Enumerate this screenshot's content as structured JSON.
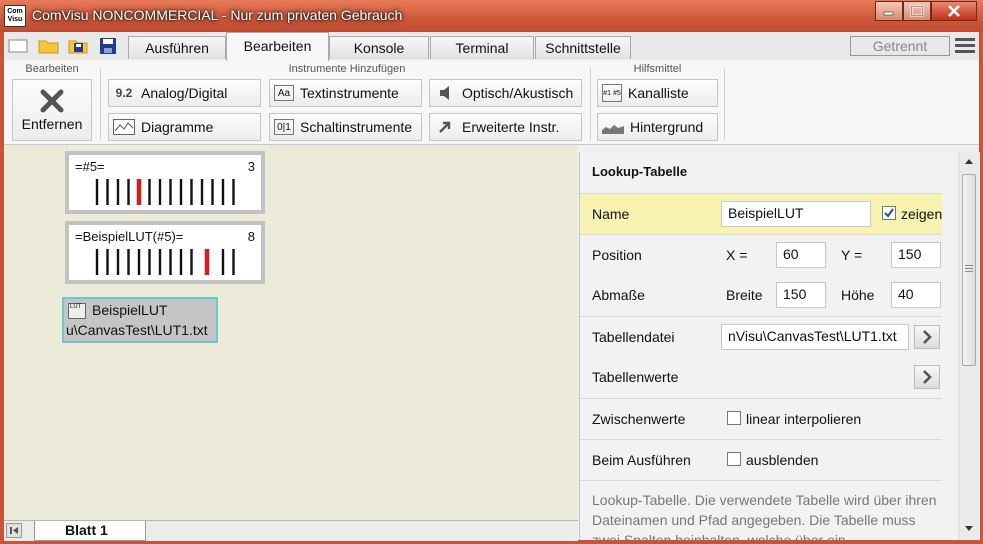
{
  "window": {
    "logo_text": "Com Visu",
    "title": "ComVisu NONCOMMERCIAL - Nur zum privaten Gebrauch"
  },
  "tabs": [
    "Ausführen",
    "Bearbeiten",
    "Konsole",
    "Terminal",
    "Schnittstelle"
  ],
  "active_tab": "Bearbeiten",
  "connection_status": "Getrennt",
  "ribbon": {
    "group_edit": "Bearbeiten",
    "group_instruments": "Instrumente Hinzufügen",
    "group_tools": "Hilfsmittel",
    "remove": "Entfernen",
    "analog_digital": "Analog/Digital",
    "analog_icon_text": "9.2",
    "text_instruments": "Textinstrumente",
    "text_icon_text": "Aa",
    "optical_acoustic": "Optisch/Akustisch",
    "channel_list": "Kanalliste",
    "channel_icon_text": "#1 #5",
    "diagrams": "Diagramme",
    "switch_instruments": "Schaltinstrumente",
    "switch_icon_text": "0|1",
    "extended_instr": "Erweiterte Instr.",
    "background": "Hintergrund"
  },
  "canvas": {
    "instrument1": {
      "label": "=#5=",
      "value": "3"
    },
    "instrument2": {
      "label": "=BeispielLUT(#5)=",
      "value": "8"
    },
    "lut": {
      "icon_text": "LUT",
      "name": "BeispielLUT",
      "path": "u\\CanvasTest\\LUT1.txt"
    },
    "sheet_tab": "Blatt 1"
  },
  "panel": {
    "title": "Lookup-Tabelle",
    "name_label": "Name",
    "name_value": "BeispielLUT",
    "show_label": "zeigen",
    "position_label": "Position",
    "x_label": "X =",
    "x_value": "60",
    "y_label": "Y =",
    "y_value": "150",
    "size_label": "Abmaße",
    "width_label": "Breite",
    "width_value": "150",
    "height_label": "Höhe",
    "height_value": "40",
    "file_label": "Tabellendatei",
    "file_value": "nVisu\\CanvasTest\\LUT1.txt",
    "values_label": "Tabellenwerte",
    "interp_label": "Zwischenwerte",
    "interp_option": "linear interpolieren",
    "exec_label": "Beim Ausführen",
    "exec_option": "ausblenden",
    "description": "Lookup-Tabelle. Die verwendete Tabelle wird über ihren Dateinamen und Pfad angegeben. Die Tabelle muss zwei Spalten beinhalten, welche über ein"
  }
}
